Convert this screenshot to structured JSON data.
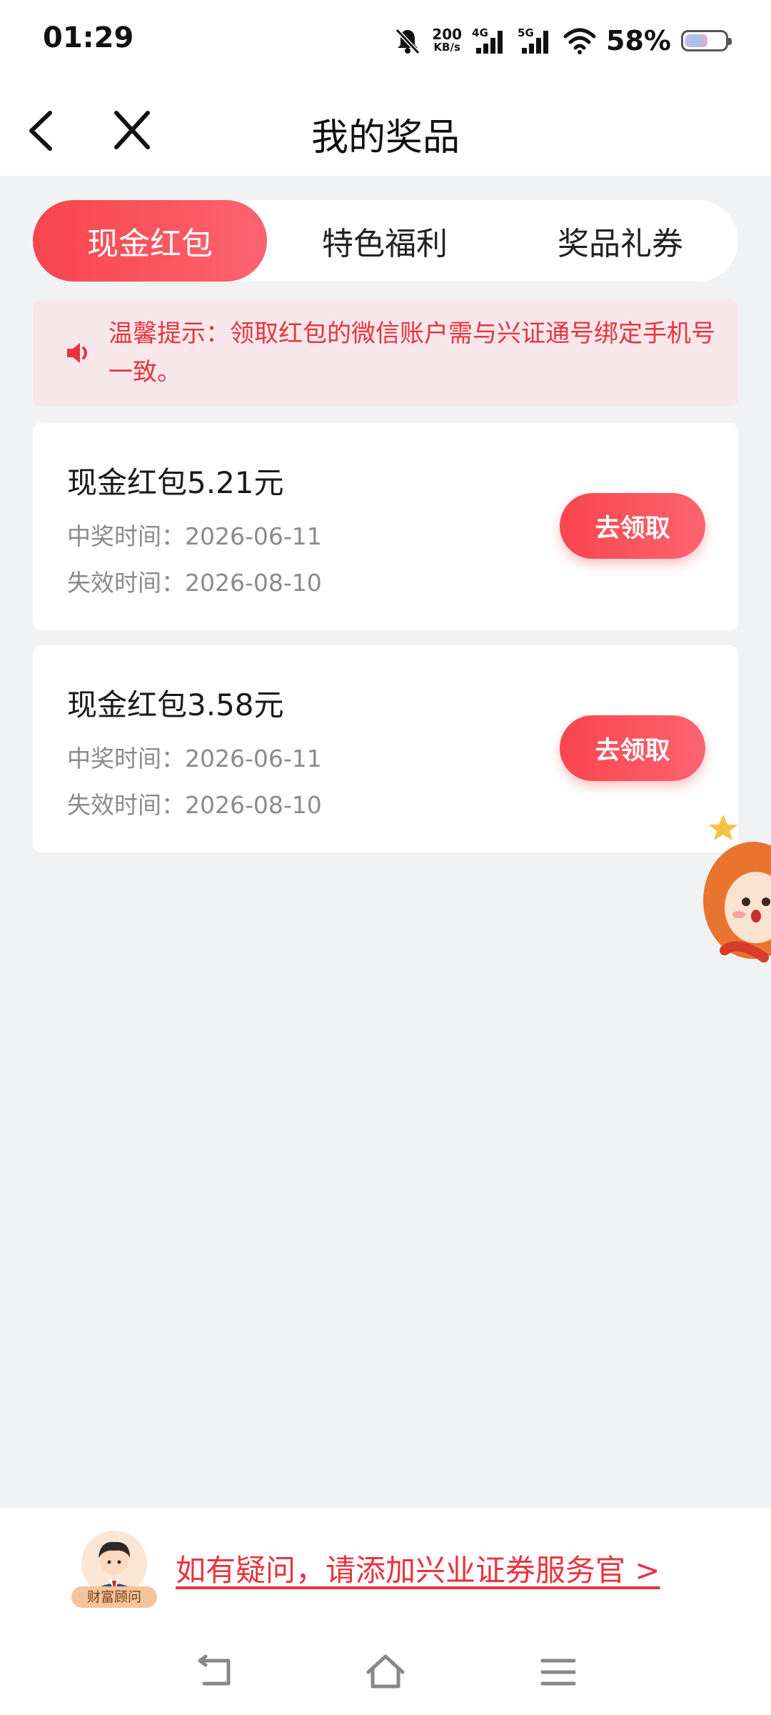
{
  "status_bar": {
    "time": "01:29",
    "net_speed_value": "200",
    "net_speed_unit": "KB/s",
    "sim1_label": "4G",
    "sim2_label": "5G",
    "battery": "58%",
    "battery_level": 58,
    "icons": [
      "bell-muted-icon",
      "signal-icon",
      "wifi-icon",
      "battery-icon"
    ]
  },
  "nav": {
    "title": "我的奖品",
    "back_icon": "chevron-left-icon",
    "close_icon": "close-icon"
  },
  "tabs": [
    {
      "label": "现金红包",
      "active": true
    },
    {
      "label": "特色福利",
      "active": false
    },
    {
      "label": "奖品礼券",
      "active": false
    }
  ],
  "notice": {
    "icon": "speaker-icon",
    "text": "温馨提示：领取红包的微信账户需与兴证通号绑定手机号一致。"
  },
  "prizes": [
    {
      "title": "现金红包5.21元",
      "win_time": "中奖时间：2026-06-11",
      "expire_time": "失效时间：2026-08-10",
      "button": "去领取"
    },
    {
      "title": "现金红包3.58元",
      "win_time": "中奖时间：2026-06-11",
      "expire_time": "失效时间：2026-08-10",
      "button": "去领取"
    }
  ],
  "footer": {
    "advisor_label": "财富顾问",
    "help_link": "如有疑问，请添加兴业证券服务官 >"
  },
  "system_nav": {
    "icons": [
      "back-gesture-icon",
      "home-icon",
      "menu-icon"
    ]
  },
  "colors": {
    "accent": "#f8454e",
    "notice_bg": "#f7e7ea",
    "page_bg": "#f1f2f4"
  }
}
